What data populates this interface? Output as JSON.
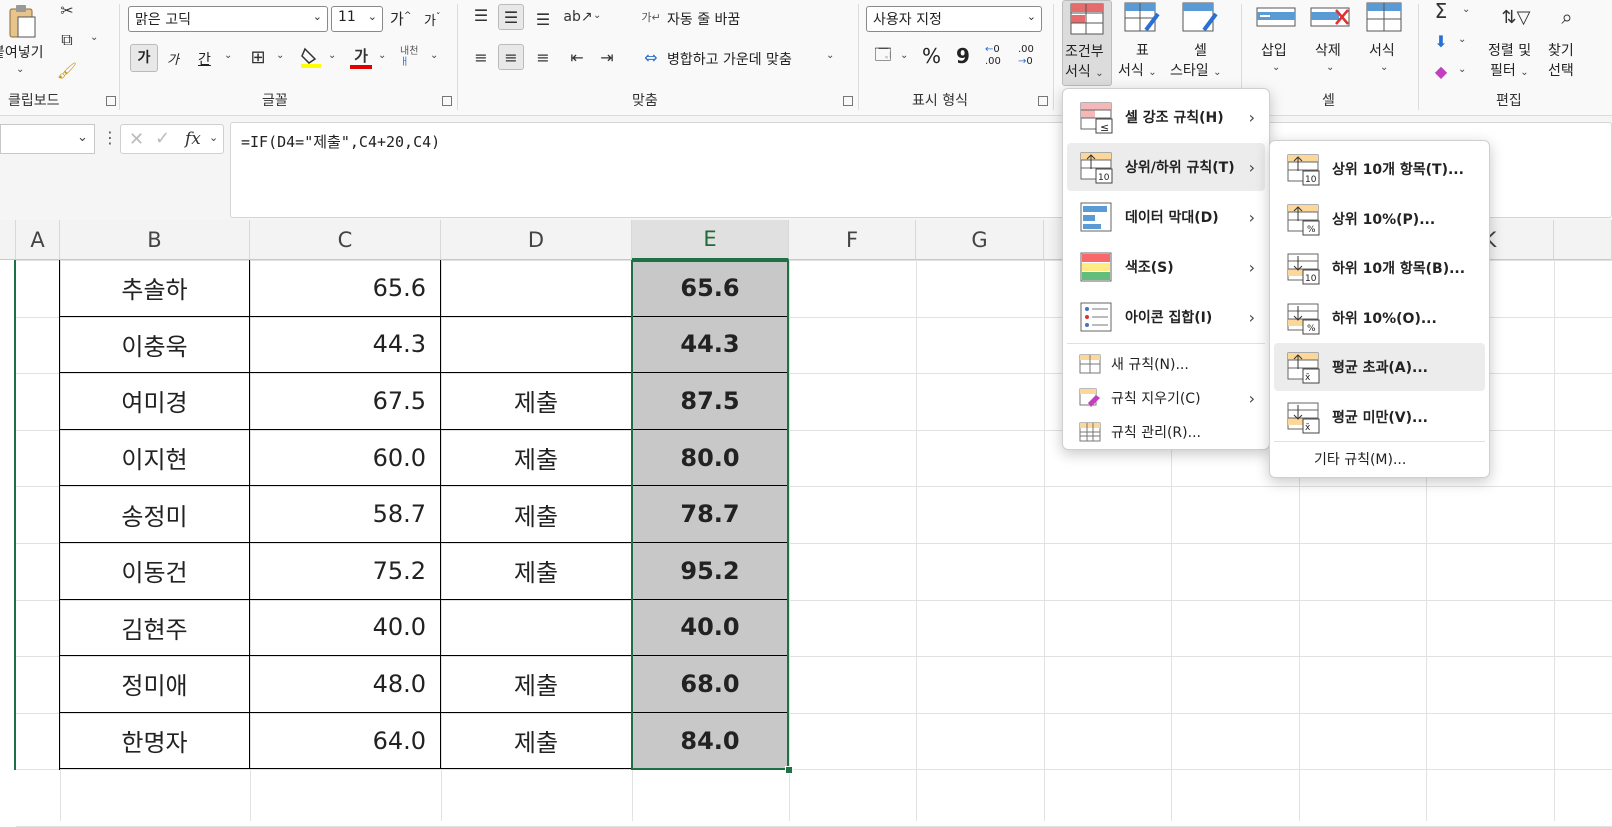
{
  "ribbon": {
    "clipboard": {
      "paste_label": "붙여넣기",
      "group_label": "클립보드"
    },
    "font": {
      "font_name": "맑은 고딕",
      "font_size": "11",
      "grow_label": "가",
      "shrink_label": "가",
      "bold_label": "가",
      "italic_label": "가",
      "underline_label": "간",
      "phonetic_label": "내천",
      "font_color_glyph": "가",
      "group_label": "글꼴"
    },
    "alignment": {
      "wrap_label": "자동 줄 바꿈",
      "merge_label": "병합하고 가운데 맞춤",
      "group_label": "맞춤"
    },
    "number": {
      "format_value": "사용자 지정",
      "percent_label": "%",
      "comma_label": "9",
      "inc_dec_label": ".00",
      "dec_dec_label": ".00",
      "group_label": "표시 형식"
    },
    "styles": {
      "conditional_label_1": "조건부",
      "conditional_label_2": "서식",
      "table_label_1": "표",
      "table_label_2": "서식",
      "cell_style_label_1": "셀",
      "cell_style_label_2": "스타일"
    },
    "cells": {
      "insert_label": "삽입",
      "delete_label": "삭제",
      "format_label": "서식",
      "group_label": "셀"
    },
    "editing": {
      "sort_label_1": "정렬 및",
      "sort_label_2": "필터",
      "find_label_1": "찾기",
      "find_label_2": "선택",
      "group_label": "편집"
    }
  },
  "formula_bar": {
    "fx_label": "fx",
    "formula": "=IF(D4=\"제출\",C4+20,C4)"
  },
  "columns": [
    "A",
    "B",
    "C",
    "D",
    "E",
    "F",
    "G",
    "K"
  ],
  "rows": [
    {
      "name": "추솔하",
      "score": "65.6",
      "submit": "",
      "result": "65.6"
    },
    {
      "name": "이충욱",
      "score": "44.3",
      "submit": "",
      "result": "44.3"
    },
    {
      "name": "여미경",
      "score": "67.5",
      "submit": "제출",
      "result": "87.5"
    },
    {
      "name": "이지현",
      "score": "60.0",
      "submit": "제출",
      "result": "80.0"
    },
    {
      "name": "송정미",
      "score": "58.7",
      "submit": "제출",
      "result": "78.7"
    },
    {
      "name": "이동건",
      "score": "75.2",
      "submit": "제출",
      "result": "95.2"
    },
    {
      "name": "김현주",
      "score": "40.0",
      "submit": "",
      "result": "40.0"
    },
    {
      "name": "정미애",
      "score": "48.0",
      "submit": "제출",
      "result": "68.0"
    },
    {
      "name": "한명자",
      "score": "64.0",
      "submit": "제출",
      "result": "84.0"
    }
  ],
  "cf_menu": {
    "items": [
      {
        "label": "셀 강조 규칙(H)",
        "icon": "highlight-cells-icon"
      },
      {
        "label": "상위/하위 규칙(T)",
        "icon": "top-bottom-icon"
      },
      {
        "label": "데이터 막대(D)",
        "icon": "data-bars-icon"
      },
      {
        "label": "색조(S)",
        "icon": "color-scales-icon"
      },
      {
        "label": "아이콘 집합(I)",
        "icon": "icon-sets-icon"
      }
    ],
    "small_items": [
      {
        "label": "새 규칙(N)...",
        "icon": "new-rule-icon"
      },
      {
        "label": "규칙 지우기(C)",
        "icon": "clear-rules-icon"
      },
      {
        "label": "규칙 관리(R)...",
        "icon": "manage-rules-icon"
      }
    ]
  },
  "submenu": {
    "items": [
      {
        "label": "상위 10개 항목(T)...",
        "badge": "10"
      },
      {
        "label": "상위 10%(P)...",
        "badge": "%"
      },
      {
        "label": "하위 10개 항목(B)...",
        "badge": "10"
      },
      {
        "label": "하위 10%(O)...",
        "badge": "%"
      },
      {
        "label": "평균 초과(A)...",
        "badge": "x̄"
      },
      {
        "label": "평균 미만(V)...",
        "badge": "x̄"
      }
    ],
    "more_label": "기타 규칙(M)..."
  }
}
